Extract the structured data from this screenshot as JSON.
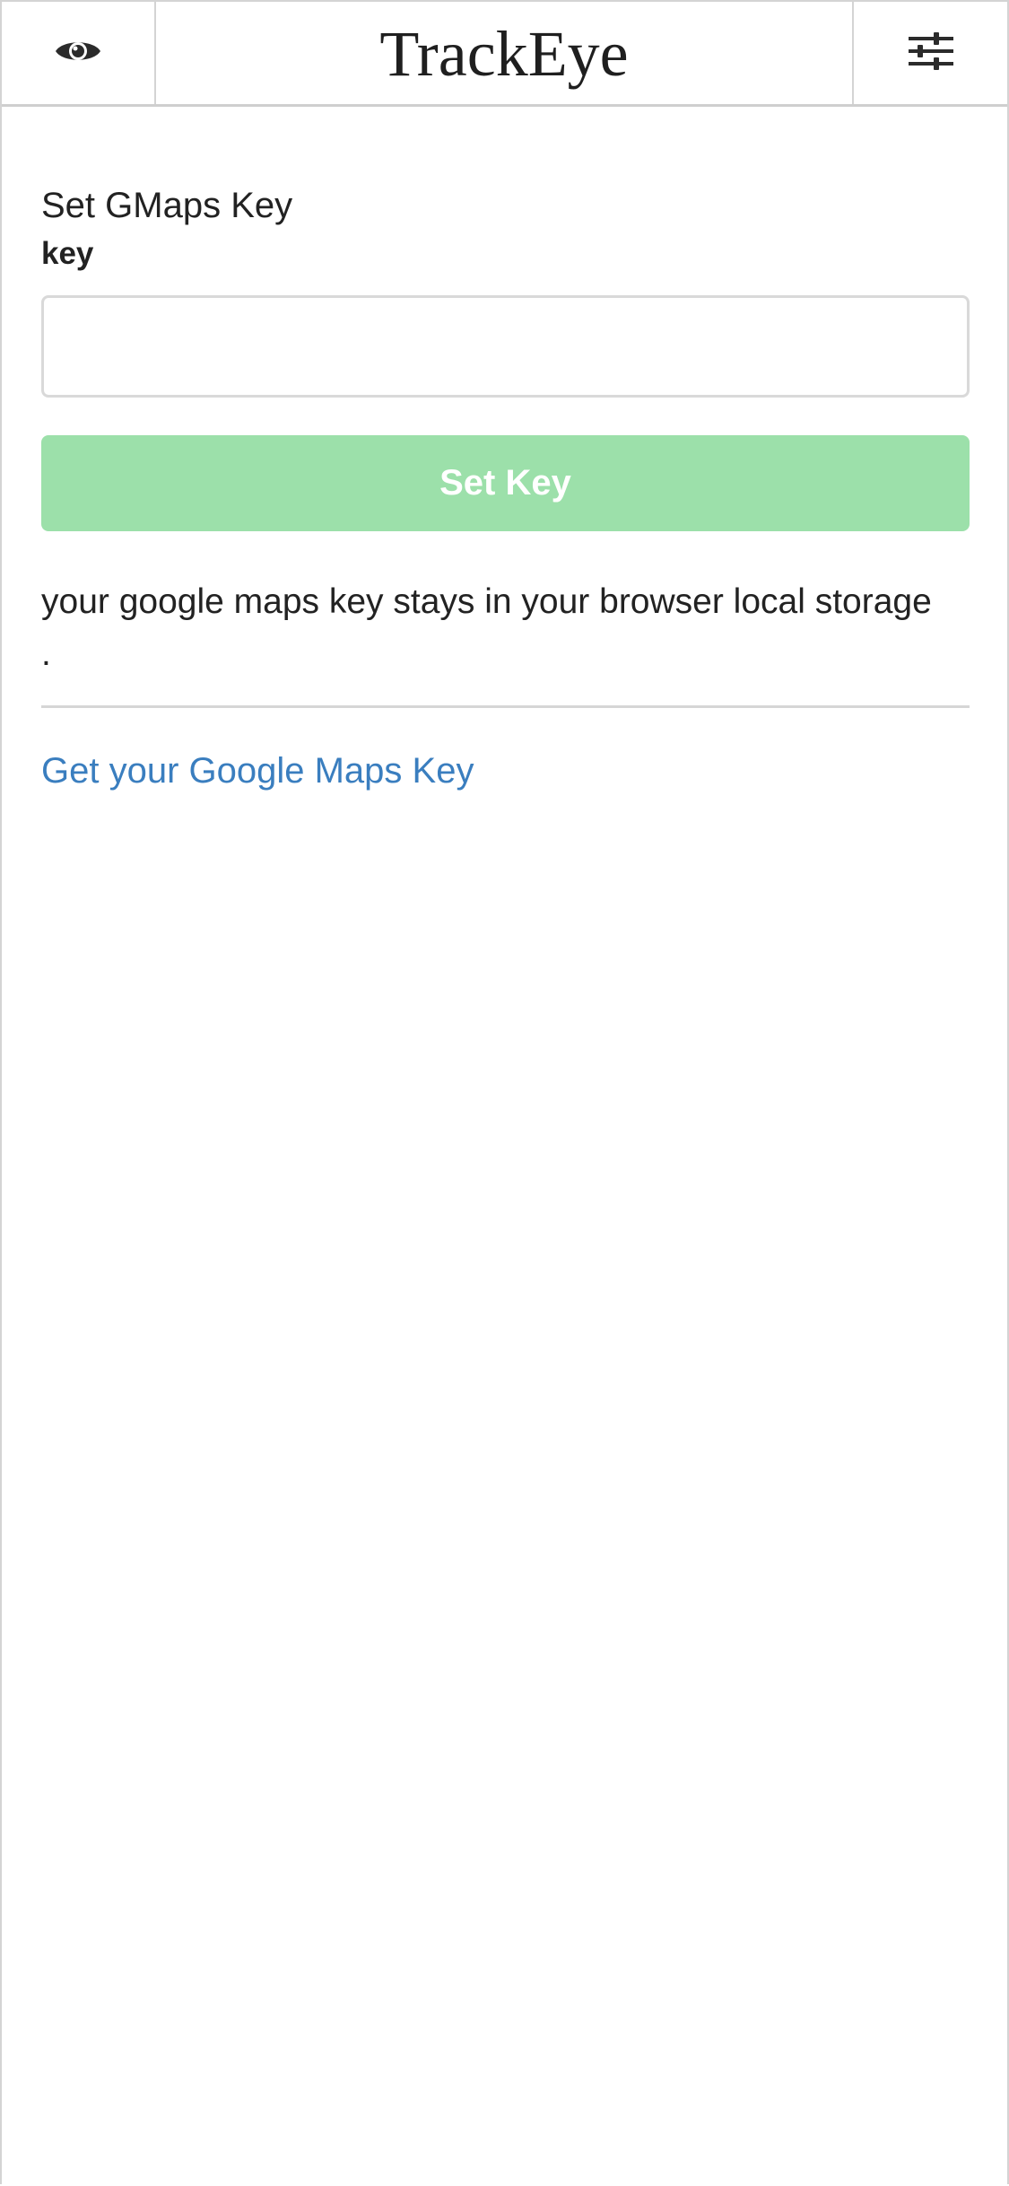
{
  "header": {
    "title": "TrackEye",
    "left_icon": "eye-icon",
    "right_icon": "sliders-icon"
  },
  "form": {
    "section_title": "Set GMaps Key",
    "field_label": "key",
    "key_value": "",
    "key_placeholder": "",
    "submit_label": "Set Key"
  },
  "note": {
    "text": "your google maps key stays in your browser local storage",
    "trailing": "."
  },
  "link": {
    "label": "Get your Google Maps Key"
  },
  "colors": {
    "button_bg": "#9ce0aa",
    "link": "#3a7ebf",
    "text": "#222222",
    "border": "#d4d4d4"
  }
}
